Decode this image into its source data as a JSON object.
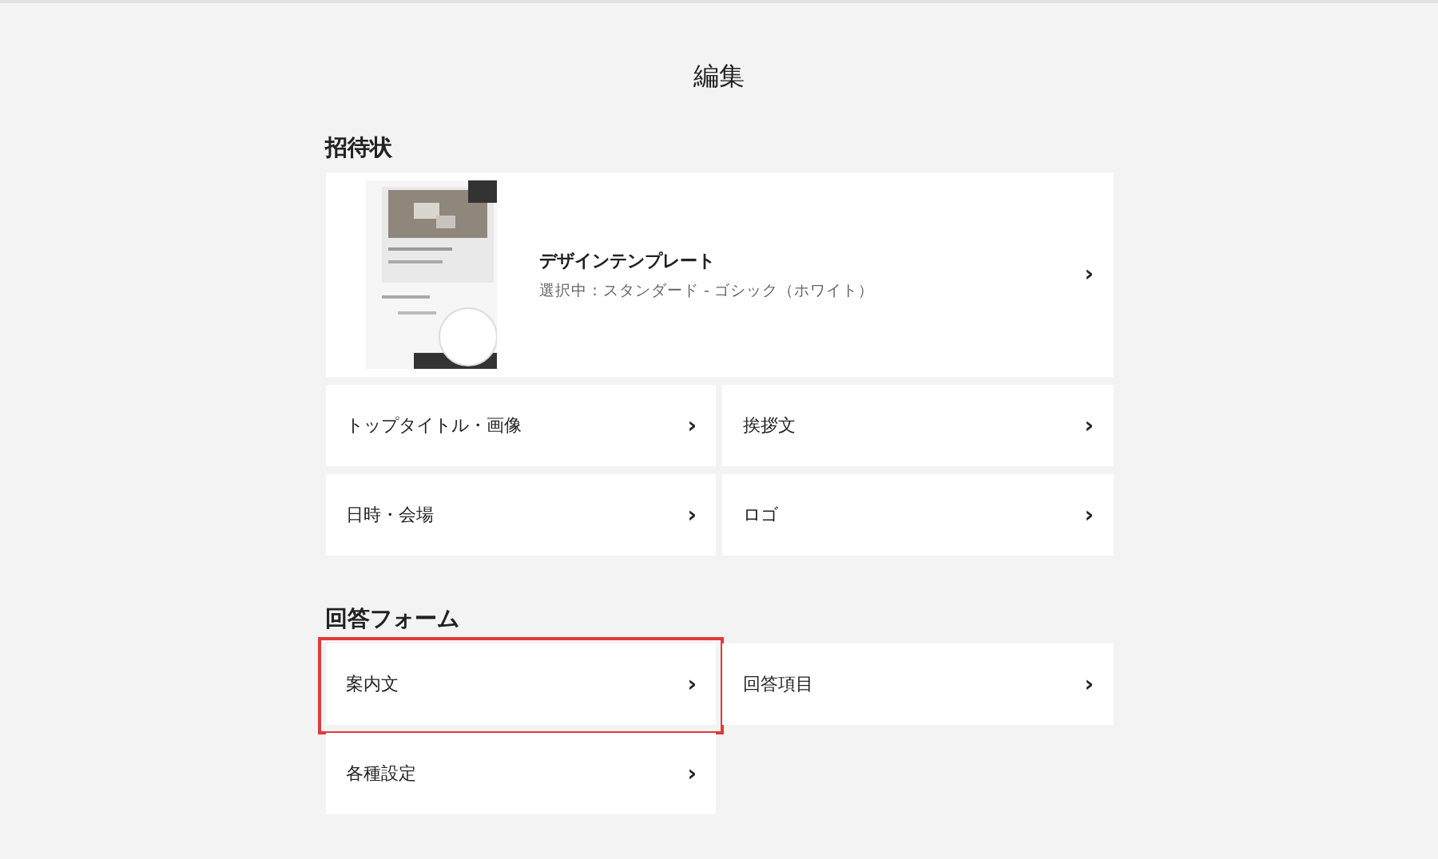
{
  "page_title": "編集",
  "sections": [
    {
      "heading": "招待状",
      "template": {
        "kind": "picture",
        "title": "デザインテンプレート",
        "subtitle": "選択中：スタンダード - ゴシック（ホワイト）",
        "chevron": "›"
      },
      "items": [
        {
          "label": "トップタイトル・画像",
          "chevron": "›",
          "highlighted": false
        },
        {
          "label": "挨拶文",
          "chevron": "›",
          "highlighted": false
        },
        {
          "label": "日時・会場",
          "chevron": "›",
          "highlighted": false
        },
        {
          "label": "ロゴ",
          "chevron": "›",
          "highlighted": false
        }
      ]
    },
    {
      "heading": "回答フォーム",
      "items": [
        {
          "label": "案内文",
          "chevron": "›",
          "highlighted": true
        },
        {
          "label": "回答項目",
          "chevron": "›",
          "highlighted": false
        },
        {
          "label": "各種設定",
          "chevron": "›",
          "highlighted": false
        }
      ]
    }
  ]
}
